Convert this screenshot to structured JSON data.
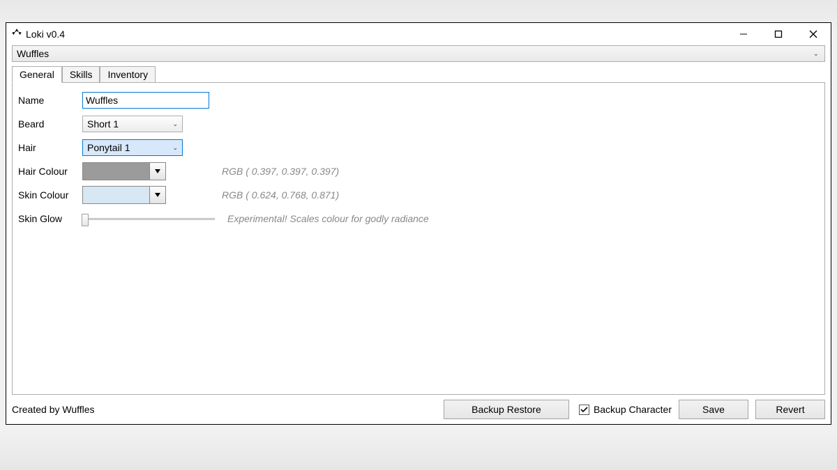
{
  "window": {
    "title": "Loki v0.4"
  },
  "toolbar": {
    "character_select": "Wuffles"
  },
  "tabs": {
    "general": "General",
    "skills": "Skills",
    "inventory": "Inventory",
    "active": "general"
  },
  "general": {
    "labels": {
      "name": "Name",
      "beard": "Beard",
      "hair": "Hair",
      "hair_colour": "Hair Colour",
      "skin_colour": "Skin Colour",
      "skin_glow": "Skin Glow"
    },
    "name_value": "Wuffles",
    "beard_value": "Short 1",
    "hair_value": "Ponytail 1",
    "hair_colour_hex": "#9b9b9b",
    "hair_colour_text": "RGB ( 0.397, 0.397, 0.397)",
    "skin_colour_hex": "#d7e7f3",
    "skin_colour_text": "RGB ( 0.624, 0.768, 0.871)",
    "skin_glow_hint": "Experimental! Scales colour for godly radiance",
    "skin_glow_value": 0
  },
  "footer": {
    "credit": "Created by Wuffles",
    "backup_restore": "Backup Restore",
    "backup_character_label": "Backup Character",
    "backup_character_checked": true,
    "save": "Save",
    "revert": "Revert"
  }
}
